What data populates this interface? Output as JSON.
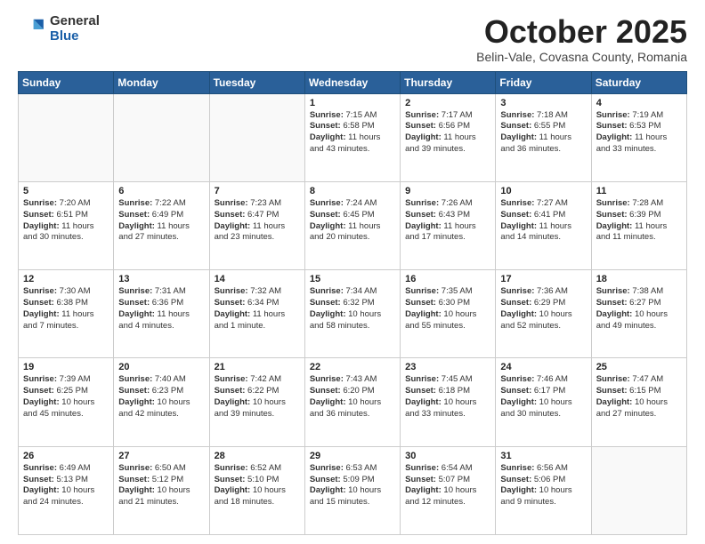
{
  "header": {
    "logo_general": "General",
    "logo_blue": "Blue",
    "title": "October 2025",
    "location": "Belin-Vale, Covasna County, Romania"
  },
  "days_of_week": [
    "Sunday",
    "Monday",
    "Tuesday",
    "Wednesday",
    "Thursday",
    "Friday",
    "Saturday"
  ],
  "weeks": [
    [
      {
        "day": "",
        "info": ""
      },
      {
        "day": "",
        "info": ""
      },
      {
        "day": "",
        "info": ""
      },
      {
        "day": "1",
        "info": "Sunrise: 7:15 AM\nSunset: 6:58 PM\nDaylight: 11 hours and 43 minutes."
      },
      {
        "day": "2",
        "info": "Sunrise: 7:17 AM\nSunset: 6:56 PM\nDaylight: 11 hours and 39 minutes."
      },
      {
        "day": "3",
        "info": "Sunrise: 7:18 AM\nSunset: 6:55 PM\nDaylight: 11 hours and 36 minutes."
      },
      {
        "day": "4",
        "info": "Sunrise: 7:19 AM\nSunset: 6:53 PM\nDaylight: 11 hours and 33 minutes."
      }
    ],
    [
      {
        "day": "5",
        "info": "Sunrise: 7:20 AM\nSunset: 6:51 PM\nDaylight: 11 hours and 30 minutes."
      },
      {
        "day": "6",
        "info": "Sunrise: 7:22 AM\nSunset: 6:49 PM\nDaylight: 11 hours and 27 minutes."
      },
      {
        "day": "7",
        "info": "Sunrise: 7:23 AM\nSunset: 6:47 PM\nDaylight: 11 hours and 23 minutes."
      },
      {
        "day": "8",
        "info": "Sunrise: 7:24 AM\nSunset: 6:45 PM\nDaylight: 11 hours and 20 minutes."
      },
      {
        "day": "9",
        "info": "Sunrise: 7:26 AM\nSunset: 6:43 PM\nDaylight: 11 hours and 17 minutes."
      },
      {
        "day": "10",
        "info": "Sunrise: 7:27 AM\nSunset: 6:41 PM\nDaylight: 11 hours and 14 minutes."
      },
      {
        "day": "11",
        "info": "Sunrise: 7:28 AM\nSunset: 6:39 PM\nDaylight: 11 hours and 11 minutes."
      }
    ],
    [
      {
        "day": "12",
        "info": "Sunrise: 7:30 AM\nSunset: 6:38 PM\nDaylight: 11 hours and 7 minutes."
      },
      {
        "day": "13",
        "info": "Sunrise: 7:31 AM\nSunset: 6:36 PM\nDaylight: 11 hours and 4 minutes."
      },
      {
        "day": "14",
        "info": "Sunrise: 7:32 AM\nSunset: 6:34 PM\nDaylight: 11 hours and 1 minute."
      },
      {
        "day": "15",
        "info": "Sunrise: 7:34 AM\nSunset: 6:32 PM\nDaylight: 10 hours and 58 minutes."
      },
      {
        "day": "16",
        "info": "Sunrise: 7:35 AM\nSunset: 6:30 PM\nDaylight: 10 hours and 55 minutes."
      },
      {
        "day": "17",
        "info": "Sunrise: 7:36 AM\nSunset: 6:29 PM\nDaylight: 10 hours and 52 minutes."
      },
      {
        "day": "18",
        "info": "Sunrise: 7:38 AM\nSunset: 6:27 PM\nDaylight: 10 hours and 49 minutes."
      }
    ],
    [
      {
        "day": "19",
        "info": "Sunrise: 7:39 AM\nSunset: 6:25 PM\nDaylight: 10 hours and 45 minutes."
      },
      {
        "day": "20",
        "info": "Sunrise: 7:40 AM\nSunset: 6:23 PM\nDaylight: 10 hours and 42 minutes."
      },
      {
        "day": "21",
        "info": "Sunrise: 7:42 AM\nSunset: 6:22 PM\nDaylight: 10 hours and 39 minutes."
      },
      {
        "day": "22",
        "info": "Sunrise: 7:43 AM\nSunset: 6:20 PM\nDaylight: 10 hours and 36 minutes."
      },
      {
        "day": "23",
        "info": "Sunrise: 7:45 AM\nSunset: 6:18 PM\nDaylight: 10 hours and 33 minutes."
      },
      {
        "day": "24",
        "info": "Sunrise: 7:46 AM\nSunset: 6:17 PM\nDaylight: 10 hours and 30 minutes."
      },
      {
        "day": "25",
        "info": "Sunrise: 7:47 AM\nSunset: 6:15 PM\nDaylight: 10 hours and 27 minutes."
      }
    ],
    [
      {
        "day": "26",
        "info": "Sunrise: 6:49 AM\nSunset: 5:13 PM\nDaylight: 10 hours and 24 minutes."
      },
      {
        "day": "27",
        "info": "Sunrise: 6:50 AM\nSunset: 5:12 PM\nDaylight: 10 hours and 21 minutes."
      },
      {
        "day": "28",
        "info": "Sunrise: 6:52 AM\nSunset: 5:10 PM\nDaylight: 10 hours and 18 minutes."
      },
      {
        "day": "29",
        "info": "Sunrise: 6:53 AM\nSunset: 5:09 PM\nDaylight: 10 hours and 15 minutes."
      },
      {
        "day": "30",
        "info": "Sunrise: 6:54 AM\nSunset: 5:07 PM\nDaylight: 10 hours and 12 minutes."
      },
      {
        "day": "31",
        "info": "Sunrise: 6:56 AM\nSunset: 5:06 PM\nDaylight: 10 hours and 9 minutes."
      },
      {
        "day": "",
        "info": ""
      }
    ]
  ]
}
